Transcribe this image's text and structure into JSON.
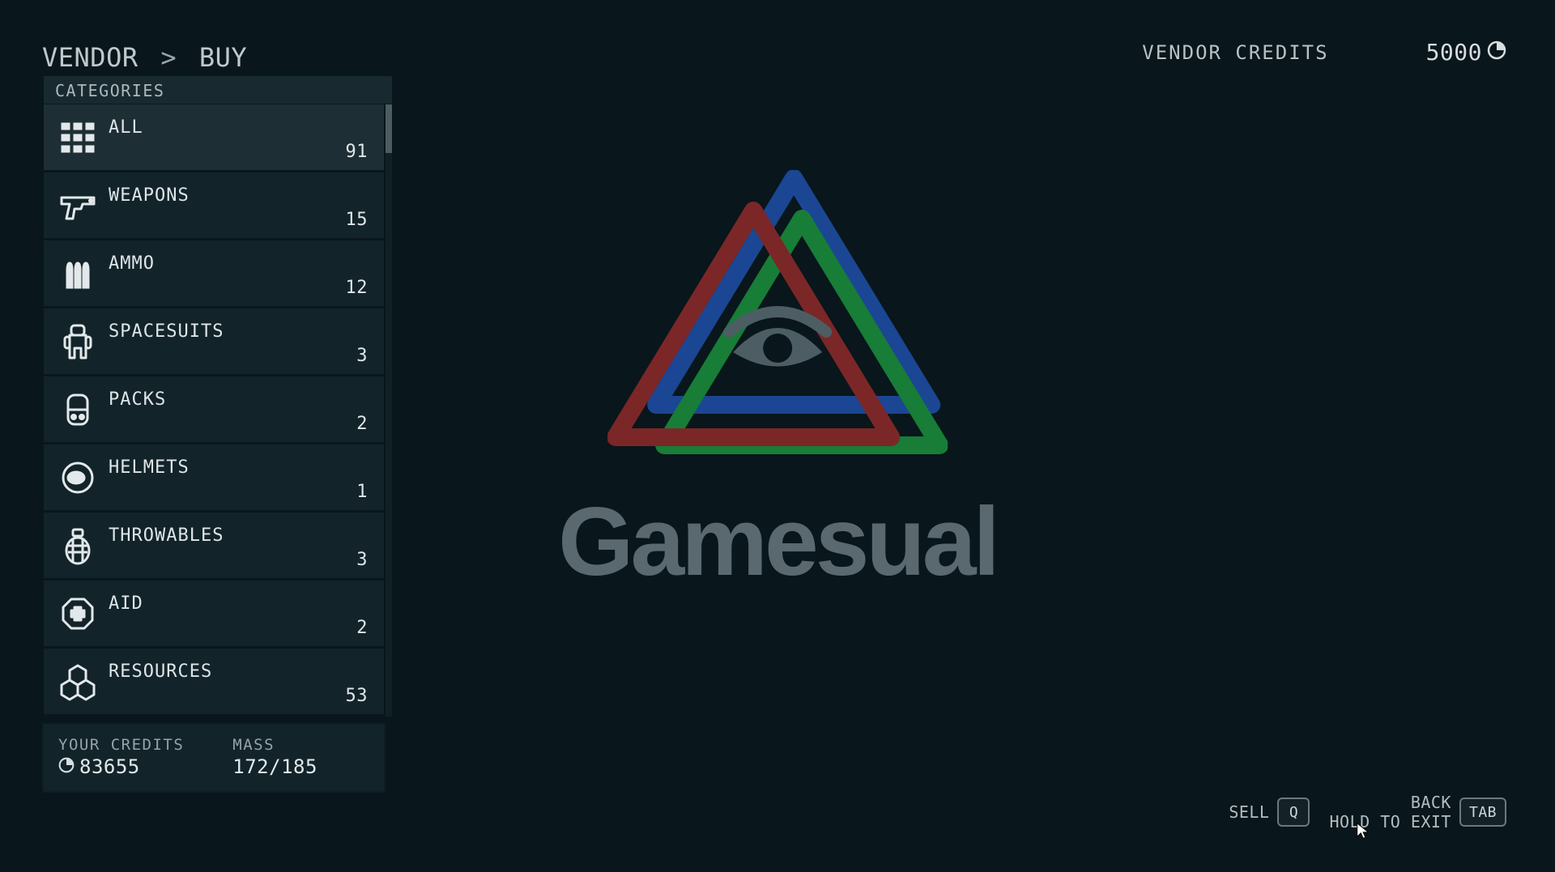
{
  "breadcrumb": {
    "a": "VENDOR",
    "sep": ">",
    "b": "BUY"
  },
  "vendor_credits": {
    "label": "VENDOR CREDITS",
    "amount": "5000"
  },
  "categories_header": "CATEGORIES",
  "categories": [
    {
      "icon": "grid",
      "label": "ALL",
      "count": "91"
    },
    {
      "icon": "pistol",
      "label": "WEAPONS",
      "count": "15"
    },
    {
      "icon": "ammo",
      "label": "AMMO",
      "count": "12"
    },
    {
      "icon": "spacesuit",
      "label": "SPACESUITS",
      "count": "3"
    },
    {
      "icon": "pack",
      "label": "PACKS",
      "count": "2"
    },
    {
      "icon": "helmet",
      "label": "HELMETS",
      "count": "1"
    },
    {
      "icon": "grenade",
      "label": "THROWABLES",
      "count": "3"
    },
    {
      "icon": "aid",
      "label": "AID",
      "count": "2"
    },
    {
      "icon": "resources",
      "label": "RESOURCES",
      "count": "53"
    }
  ],
  "player": {
    "credits_label": "YOUR CREDITS",
    "credits_value": "83655",
    "mass_label": "MASS",
    "mass_value": "172/185"
  },
  "controls": {
    "sell_label": "SELL",
    "sell_key": "Q",
    "back_label": "BACK",
    "hold_label": "HOLD TO EXIT",
    "back_key": "TAB"
  },
  "watermark": {
    "text": "Gamesual"
  }
}
